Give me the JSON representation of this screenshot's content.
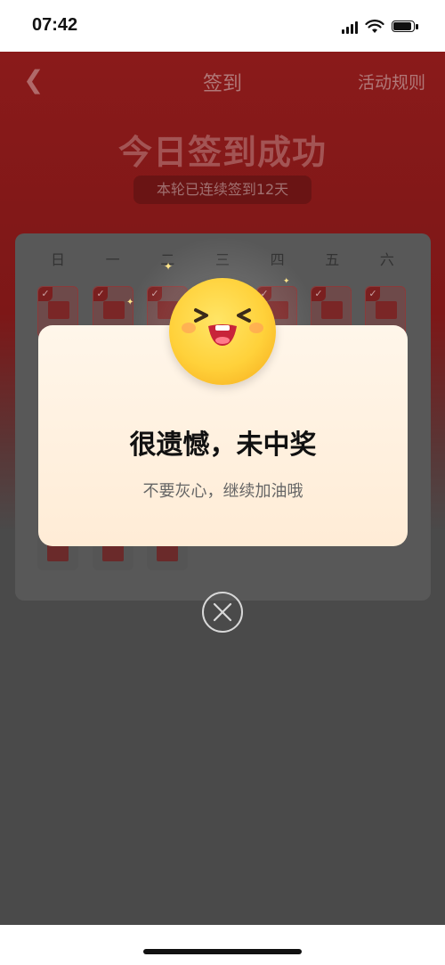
{
  "status_bar": {
    "time": "07:42"
  },
  "nav": {
    "title": "签到",
    "rules": "活动规则"
  },
  "header": {
    "title": "今日签到成功",
    "streak": "本轮已连续签到12天"
  },
  "calendar": {
    "weekdays": [
      "日",
      "一",
      "二",
      "三",
      "四",
      "五",
      "六"
    ]
  },
  "dialog": {
    "title": "很遗憾，未中奖",
    "message": "不要灰心，继续加油哦"
  },
  "colors": {
    "accent_red": "#8a1a1a",
    "dialog_bg": "#fff6ea",
    "mascot_yellow": "#ffd13a"
  }
}
